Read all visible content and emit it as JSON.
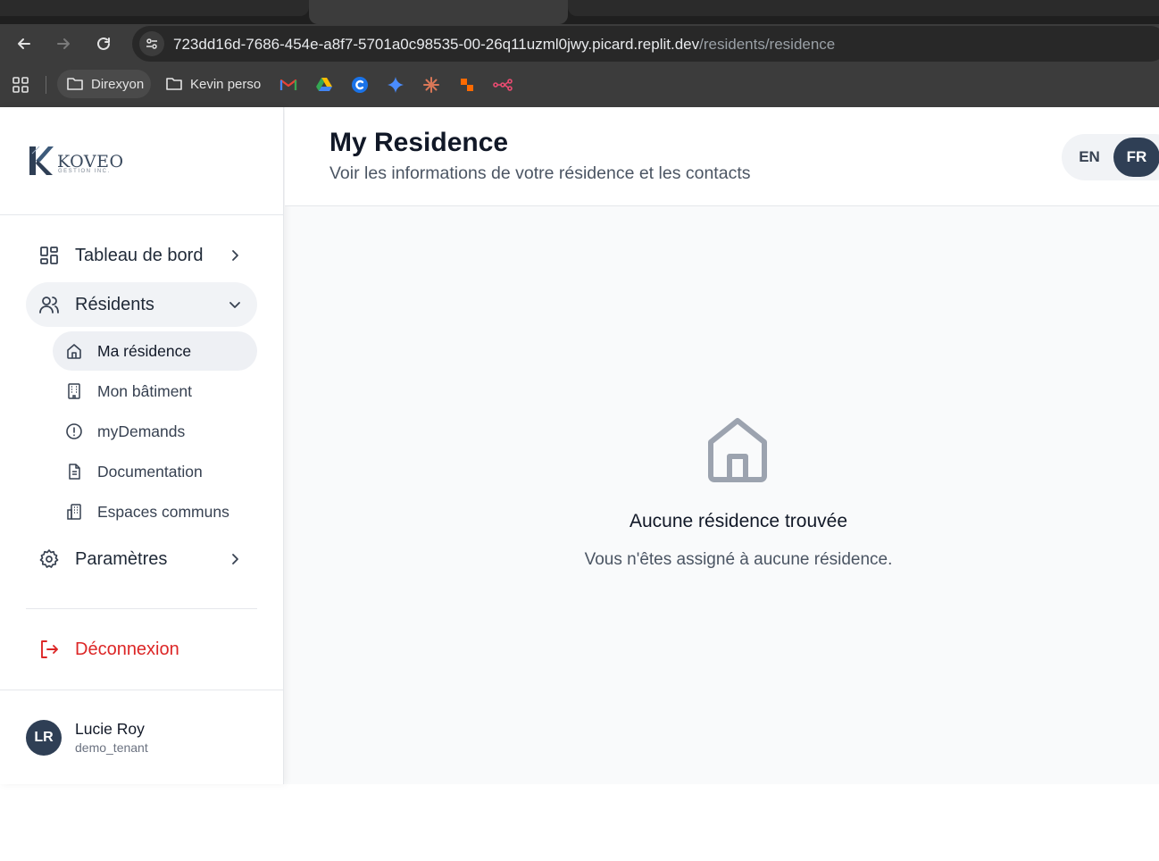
{
  "browser": {
    "url_host": "723dd16d-7686-454e-a8f7-5701a0c98535-00-26q11uzml0jwy.picard.replit.dev",
    "url_path": "/residents/residence",
    "bookmarks": [
      {
        "label": "Direxyon",
        "icon": "folder-icon"
      },
      {
        "label": "Kevin perso",
        "icon": "folder-icon"
      }
    ],
    "favicons": [
      "gmail-icon",
      "google-drive-icon",
      "c-icon",
      "gemini-icon",
      "claude-icon",
      "zapier-icon",
      "n8n-icon"
    ]
  },
  "sidebar": {
    "logo_text": "KOVEO",
    "logo_sub": "GESTION INC.",
    "nav": {
      "dashboard": "Tableau de bord",
      "residents": "Résidents",
      "settings": "Paramètres",
      "logout": "Déconnexion"
    },
    "sub_items": {
      "residence": "Ma résidence",
      "building": "Mon bâtiment",
      "demands": "myDemands",
      "documentation": "Documentation",
      "common_spaces": "Espaces communs"
    },
    "user": {
      "initials": "LR",
      "name": "Lucie Roy",
      "role": "demo_tenant"
    }
  },
  "header": {
    "title": "My Residence",
    "subtitle": "Voir les informations de votre résidence et les contacts",
    "lang_en": "EN",
    "lang_fr": "FR",
    "selected_language": "FR"
  },
  "empty_state": {
    "icon": "home-icon",
    "title": "Aucune résidence trouvée",
    "message": "Vous n'êtes assigné à aucune résidence."
  },
  "colors": {
    "accent": "#2f3f55",
    "logout": "#dc2626",
    "background": "#f9fafb"
  }
}
